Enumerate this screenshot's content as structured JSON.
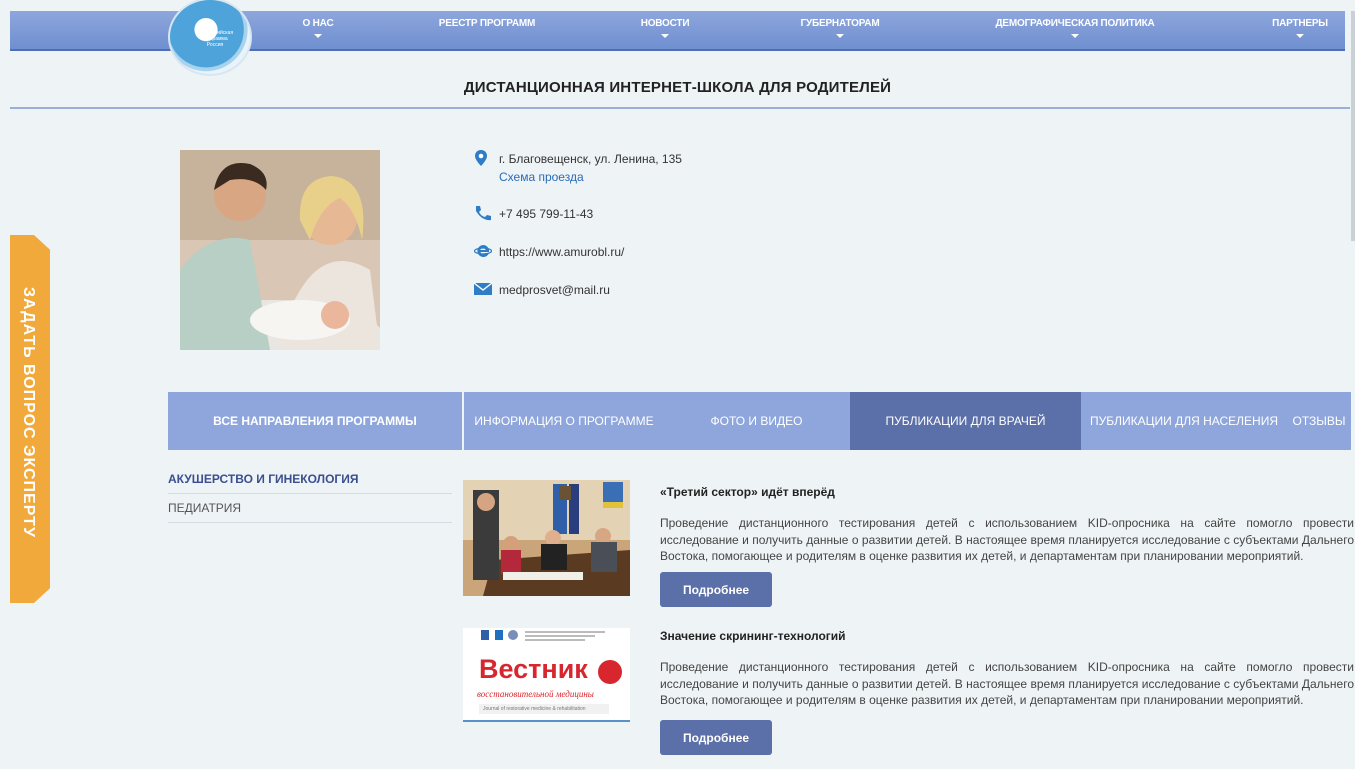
{
  "nav": {
    "logo_text": "Всероссийская программа Россия",
    "items": [
      {
        "label": "О НАС",
        "has_caret": true
      },
      {
        "label": "РЕЕСТР ПРОГРАММ",
        "has_caret": false
      },
      {
        "label": "НОВОСТИ",
        "has_caret": true
      },
      {
        "label": "ГУБЕРНАТОРАМ",
        "has_caret": true
      },
      {
        "label": "ДЕМОГРАФИЧЕСКАЯ ПОЛИТИКА",
        "has_caret": true
      },
      {
        "label": "ПАРТНЕРЫ",
        "has_caret": true
      }
    ]
  },
  "page_title": "ДИСТАНЦИОННАЯ ИНТЕРНЕТ-ШКОЛА ДЛЯ РОДИТЕЛЕЙ",
  "side_tab": "ЗАДАТЬ ВОПРОС ЭКСПЕРТУ",
  "contacts": {
    "address": "г. Благовещенск, ул. Ленина, 135",
    "route_link": "Схема проезда",
    "phone": "+7 495 799-11-43",
    "website": "https://www.amurobl.ru/",
    "email": "medprosvet@mail.ru"
  },
  "directions": {
    "header": "ВСЕ НАПРАВЛЕНИЯ ПРОГРАММЫ",
    "items": [
      "АКУШЕРСТВО И ГИНЕКОЛОГИЯ",
      "ПЕДИАТРИЯ"
    ]
  },
  "tabs": [
    "ИНФОРМАЦИЯ О ПРОГРАММЕ",
    "ФОТО И ВИДЕО",
    "ПУБЛИКАЦИИ ДЛЯ ВРАЧЕЙ",
    "ПУБЛИКАЦИИ ДЛЯ НАСЕЛЕНИЯ",
    "ОТЗЫВЫ"
  ],
  "active_tab": "ПУБЛИКАЦИИ ДЛЯ ВРАЧЕЙ",
  "publications": [
    {
      "title": "«Третий сектор» идёт вперёд",
      "text": "Проведение дистанционного тестирования детей с использованием KID-опросника на сайте помогло провести исследование и получить данные о развитии детей. В настоящее время планируется исследование с субъектами Дальнего Востока, помогающее и родителям в оценке развития их детей, и департаментам при планировании мероприятий.",
      "button": "Подробнее"
    },
    {
      "title": "Значение скрининг-технологий",
      "text": "Проведение дистанционного тестирования детей с использованием KID-опросника на сайте помогло провести исследование и получить данные о развитии детей. В настоящее время планируется исследование с субъектами Дальнего Востока, помогающее и родителям в оценке развития их детей, и департаментам при планировании мероприятий.",
      "button": "Подробнее",
      "image_title": "Вестник",
      "image_subtitle": "восстановительной медицины",
      "image_caption": "Journal of restorative medicine & rehabilitation"
    }
  ]
}
